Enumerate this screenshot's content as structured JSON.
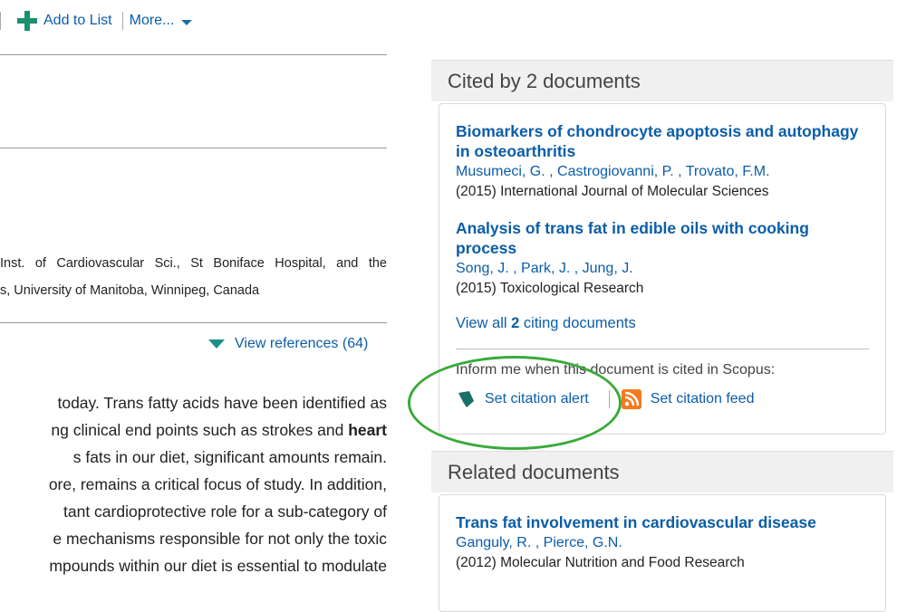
{
  "toolbar": {
    "add_to_list": "Add to List",
    "more": "More..."
  },
  "affiliation": {
    "line1": "Inst. of Cardiovascular Sci., St Boniface Hospital, and the",
    "line2": "s, University of Manitoba, Winnipeg, Canada"
  },
  "view_references": "View references (64)",
  "abstract": {
    "lines": [
      "today. Trans fatty acids have been identified as",
      "ng clinical end points such as strokes and ",
      "s fats in our diet, significant amounts remain.",
      "ore, remains a critical focus of study. In addition,",
      "tant cardioprotective role for a sub-category of",
      "e mechanisms responsible for not only the toxic",
      "mpounds within our diet is essential to modulate"
    ],
    "bold_word": "heart"
  },
  "cited_by": {
    "header": "Cited by 2 documents",
    "documents": [
      {
        "title": "Biomarkers of chondrocyte apoptosis and autophagy in osteoarthritis",
        "authors": [
          "Musumeci, G.",
          "Castrogiovanni, P.",
          "Trovato, F.M."
        ],
        "source": "(2015) International Journal of Molecular Sciences"
      },
      {
        "title": "Analysis of trans fat in edible oils with cooking process",
        "authors": [
          "Song, J.",
          "Park, J.",
          "Jung, J."
        ],
        "source": "(2015) Toxicological Research"
      }
    ],
    "view_all_prefix": "View all ",
    "view_all_count": "2",
    "view_all_suffix": " citing documents",
    "inform_text": "Inform me when this document is cited in Scopus:",
    "set_alert": "Set citation alert",
    "set_feed": "Set citation feed"
  },
  "related": {
    "header": "Related documents",
    "documents": [
      {
        "title": "Trans fat involvement in cardiovascular disease",
        "authors": [
          "Ganguly, R.",
          "Pierce, G.N."
        ],
        "source": "(2012) Molecular Nutrition and Food Research"
      }
    ]
  },
  "colors": {
    "link": "#0b5da8",
    "accent_green": "#1c8f6f",
    "annotation_oval": "#3aaa3a",
    "rss": "#f47b20"
  }
}
